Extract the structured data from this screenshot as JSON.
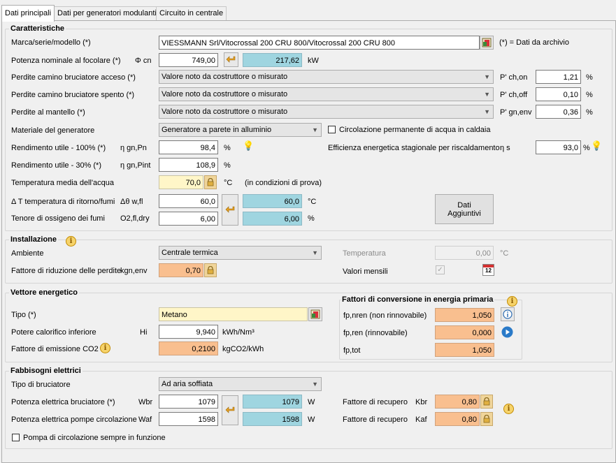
{
  "tabs": [
    "Dati principali",
    "Dati per generatori modulanti",
    "Circuito in centrale"
  ],
  "caratteristiche": {
    "title": "Caratteristiche",
    "marca_label": "Marca/serie/modello (*)",
    "marca_value": "VIESSMANN Srl/Vitocrossal 200 CRU 800/Vitocrossal 200 CRU 800",
    "archivio_note": "(*) = Dati da archivio",
    "potenza_label": "Potenza nominale al focolare (*)",
    "potenza_sym": "Φ cn",
    "potenza_value": "749,00",
    "potenza_calc": "217,62",
    "potenza_unit": "kW",
    "perdite_acceso_label": "Perdite camino bruciatore acceso (*)",
    "perdite_acceso_sel": "Valore noto da costruttore o misurato",
    "perdite_acceso_sym": "P' ch,on",
    "perdite_acceso_value": "1,21",
    "perdite_spento_label": "Perdite camino bruciatore spento (*)",
    "perdite_spento_sel": "Valore noto da costruttore o misurato",
    "perdite_spento_sym": "P' ch,off",
    "perdite_spento_value": "0,10",
    "perdite_mantello_label": "Perdite al mantello (*)",
    "perdite_mantello_sel": "Valore noto da costruttore o misurato",
    "perdite_mantello_sym": "P' gn,env",
    "perdite_mantello_value": "0,36",
    "percent": "%",
    "materiale_label": "Materiale del generatore",
    "materiale_sel": "Generatore a parete in alluminio",
    "circolazione_label": "Circolazione permanente di acqua in caldaia",
    "rend100_label": "Rendimento utile - 100% (*)",
    "rend100_sym": "η gn,Pn",
    "rend100_value": "98,4",
    "efficienza_label": "Efficienza energetica stagionale per riscaldamento",
    "efficienza_sym": "η s",
    "efficienza_value": "93,0",
    "rend30_label": "Rendimento utile - 30% (*)",
    "rend30_sym": "η gn,Pint",
    "rend30_value": "108,9",
    "temp_label": "Temperatura media dell'acqua",
    "temp_value": "70,0",
    "temp_unit": "°C",
    "temp_note": "(in condizioni di prova)",
    "dt_label": "Δ T temperatura di ritorno/fumi",
    "dt_sym": "Δθ w,fl",
    "dt_value": "60,0",
    "dt_calc": "60,0",
    "dt_unit": "°C",
    "o2_label": "Tenore di ossigeno dei fumi",
    "o2_sym": "O2,fl,dry",
    "o2_value": "6,00",
    "o2_calc": "6,00",
    "dati_aggiuntivi": "Dati Aggiuntivi"
  },
  "installazione": {
    "title": "Installazione",
    "ambiente_label": "Ambiente",
    "ambiente_sel": "Centrale termica",
    "temperatura_label": "Temperatura",
    "temperatura_value": "0,00",
    "temperatura_unit": "°C",
    "fattore_label": "Fattore di riduzione delle perdite",
    "fattore_sym": "kgn,env",
    "fattore_value": "0,70",
    "mensili_label": "Valori mensili",
    "calendar_day": "12"
  },
  "vettore": {
    "title": "Vettore energetico",
    "tipo_label": "Tipo (*)",
    "tipo_value": "Metano",
    "potere_label": "Potere calorifico inferiore",
    "potere_sym": "Hi",
    "potere_value": "9,940",
    "potere_unit": "kWh/Nm³",
    "emissione_label": "Fattore di emissione CO2",
    "emissione_value": "0,2100",
    "emissione_unit": "kgCO2/kWh",
    "fattori_title": "Fattori di conversione in energia primaria",
    "fpnren_label": "fp,nren (non rinnovabile)",
    "fpnren_value": "1,050",
    "fpren_label": "fp,ren (rinnovabile)",
    "fpren_value": "0,000",
    "fptot_label": "fp,tot",
    "fptot_value": "1,050"
  },
  "fabbisogni": {
    "title": "Fabbisogni elettrici",
    "tipo_label": "Tipo di bruciatore",
    "tipo_sel": "Ad aria soffiata",
    "wbr_label": "Potenza elettrica bruciatore (*)",
    "wbr_sym": "Wbr",
    "wbr_value": "1079",
    "wbr_calc": "1079",
    "waf_label": "Potenza elettrica pompe circolazione",
    "waf_sym": "Waf",
    "waf_value": "1598",
    "waf_calc": "1598",
    "w_unit": "W",
    "kbr_label": "Fattore di recupero",
    "kbr_sym": "Kbr",
    "kbr_value": "0,80",
    "kaf_label": "Fattore di recupero",
    "kaf_sym": "Kaf",
    "kaf_value": "0,80",
    "pompa_label": "Pompa di circolazione sempre in funzione"
  }
}
